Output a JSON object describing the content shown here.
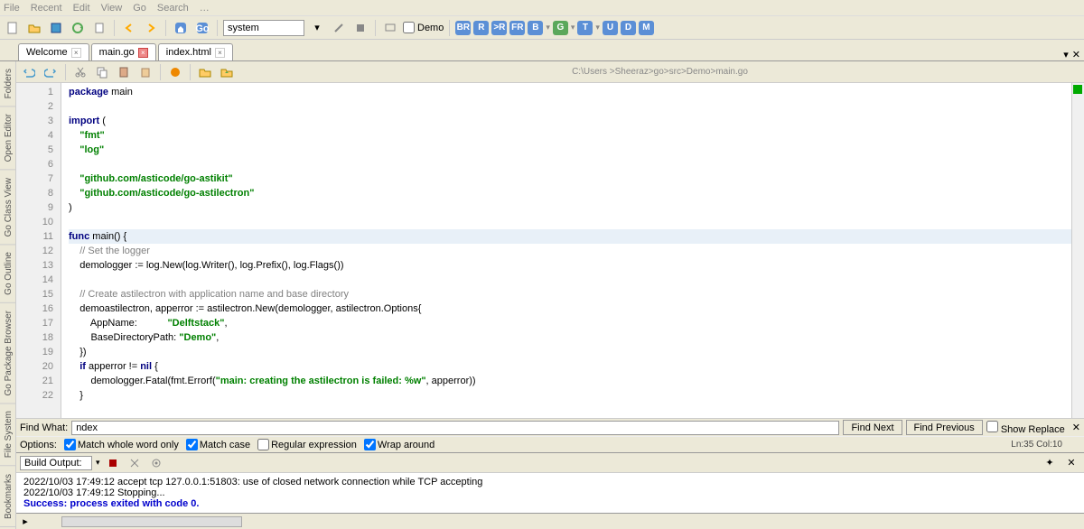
{
  "menubar": [
    "File",
    "Recent",
    "Edit",
    "View",
    "Go",
    "Search",
    "…"
  ],
  "toolbar": {
    "combo_value": "system",
    "demo_label": "Demo",
    "badges": [
      {
        "t": "BR",
        "c": "#5b8fd6"
      },
      {
        "t": "R",
        "c": "#5b8fd6"
      },
      {
        "t": ">R",
        "c": "#5b8fd6"
      },
      {
        "t": "FR",
        "c": "#5b8fd6"
      },
      {
        "t": "B",
        "c": "#5b8fd6"
      },
      {
        "t": "G",
        "c": "#5ba85b"
      },
      {
        "t": "T",
        "c": "#5b8fd6"
      },
      {
        "t": "U",
        "c": "#5b8fd6"
      },
      {
        "t": "D",
        "c": "#5b8fd6"
      },
      {
        "t": "M",
        "c": "#5b8fd6"
      }
    ]
  },
  "tabs": [
    {
      "label": "Welcome",
      "active": false
    },
    {
      "label": "main.go",
      "active": true
    },
    {
      "label": "index.html",
      "active": false
    }
  ],
  "side_tabs": [
    "Folders",
    "Open Editor",
    "Go Class View",
    "Go Outline",
    "Go Package Browser",
    "File System",
    "Bookmarks"
  ],
  "editor_path": "C:\\Users >Sheeraz>go>src>Demo>main.go",
  "code_lines": [
    {
      "n": 1,
      "h": [
        [
          "kw",
          "package"
        ],
        [
          "",
          " main"
        ]
      ]
    },
    {
      "n": 2,
      "h": []
    },
    {
      "n": 3,
      "h": [
        [
          "kw",
          "import"
        ],
        [
          "",
          " ("
        ]
      ]
    },
    {
      "n": 4,
      "h": [
        [
          "",
          "    "
        ],
        [
          "str",
          "\"fmt\""
        ]
      ]
    },
    {
      "n": 5,
      "h": [
        [
          "",
          "    "
        ],
        [
          "str",
          "\"log\""
        ]
      ]
    },
    {
      "n": 6,
      "h": []
    },
    {
      "n": 7,
      "h": [
        [
          "",
          "    "
        ],
        [
          "str",
          "\"github.com/asticode/go-astikit\""
        ]
      ]
    },
    {
      "n": 8,
      "h": [
        [
          "",
          "    "
        ],
        [
          "str",
          "\"github.com/asticode/go-astilectron\""
        ]
      ]
    },
    {
      "n": 9,
      "h": [
        [
          "",
          ")"
        ]
      ]
    },
    {
      "n": 10,
      "h": []
    },
    {
      "n": 11,
      "hl": true,
      "h": [
        [
          "kw",
          "func"
        ],
        [
          "",
          " main() {"
        ]
      ]
    },
    {
      "n": 12,
      "h": [
        [
          "",
          "    "
        ],
        [
          "cmt",
          "// Set the logger"
        ]
      ]
    },
    {
      "n": 13,
      "h": [
        [
          "",
          "    demologger := log.New(log.Writer(), log.Prefix(), log.Flags())"
        ]
      ]
    },
    {
      "n": 14,
      "h": []
    },
    {
      "n": 15,
      "h": [
        [
          "",
          "    "
        ],
        [
          "cmt",
          "// Create astilectron with application name and base directory"
        ]
      ]
    },
    {
      "n": 16,
      "h": [
        [
          "",
          "    demoastilectron, apperror := astilectron.New(demologger, astilectron.Options{"
        ]
      ]
    },
    {
      "n": 17,
      "h": [
        [
          "",
          "        AppName:           "
        ],
        [
          "str",
          "\"Delftstack\""
        ],
        [
          "",
          ","
        ]
      ]
    },
    {
      "n": 18,
      "h": [
        [
          "",
          "        BaseDirectoryPath: "
        ],
        [
          "str",
          "\"Demo\""
        ],
        [
          "",
          ","
        ]
      ]
    },
    {
      "n": 19,
      "h": [
        [
          "",
          "    })"
        ]
      ]
    },
    {
      "n": 20,
      "h": [
        [
          "",
          "    "
        ],
        [
          "kw",
          "if"
        ],
        [
          "",
          " apperror != "
        ],
        [
          "kw",
          "nil"
        ],
        [
          "",
          " {"
        ]
      ]
    },
    {
      "n": 21,
      "h": [
        [
          "",
          "        demologger.Fatal(fmt.Errorf("
        ],
        [
          "str",
          "\"main: creating the astilectron is failed: %w\""
        ],
        [
          "",
          ", apperror))"
        ]
      ]
    },
    {
      "n": 22,
      "h": [
        [
          "",
          "    }"
        ]
      ]
    }
  ],
  "find": {
    "label": "Find What:",
    "value": "ndex",
    "next": "Find Next",
    "prev": "Find Previous",
    "show_replace": "Show Replace"
  },
  "options": {
    "label": "Options:",
    "whole_word": "Match whole word only",
    "match_case": "Match case",
    "regex": "Regular expression",
    "wrap": "Wrap around",
    "status": "Ln:35 Col:10"
  },
  "build": {
    "combo": "Build Output:",
    "lines": [
      {
        "cls": "err",
        "t": "2022/10/03 17:49:12 accept tcp 127.0.0.1:51803: use of closed network connection while TCP accepting"
      },
      {
        "cls": "err",
        "t": "2022/10/03 17:49:12 Stopping..."
      },
      {
        "cls": "ok",
        "t": "Success: process exited with code 0."
      }
    ]
  }
}
